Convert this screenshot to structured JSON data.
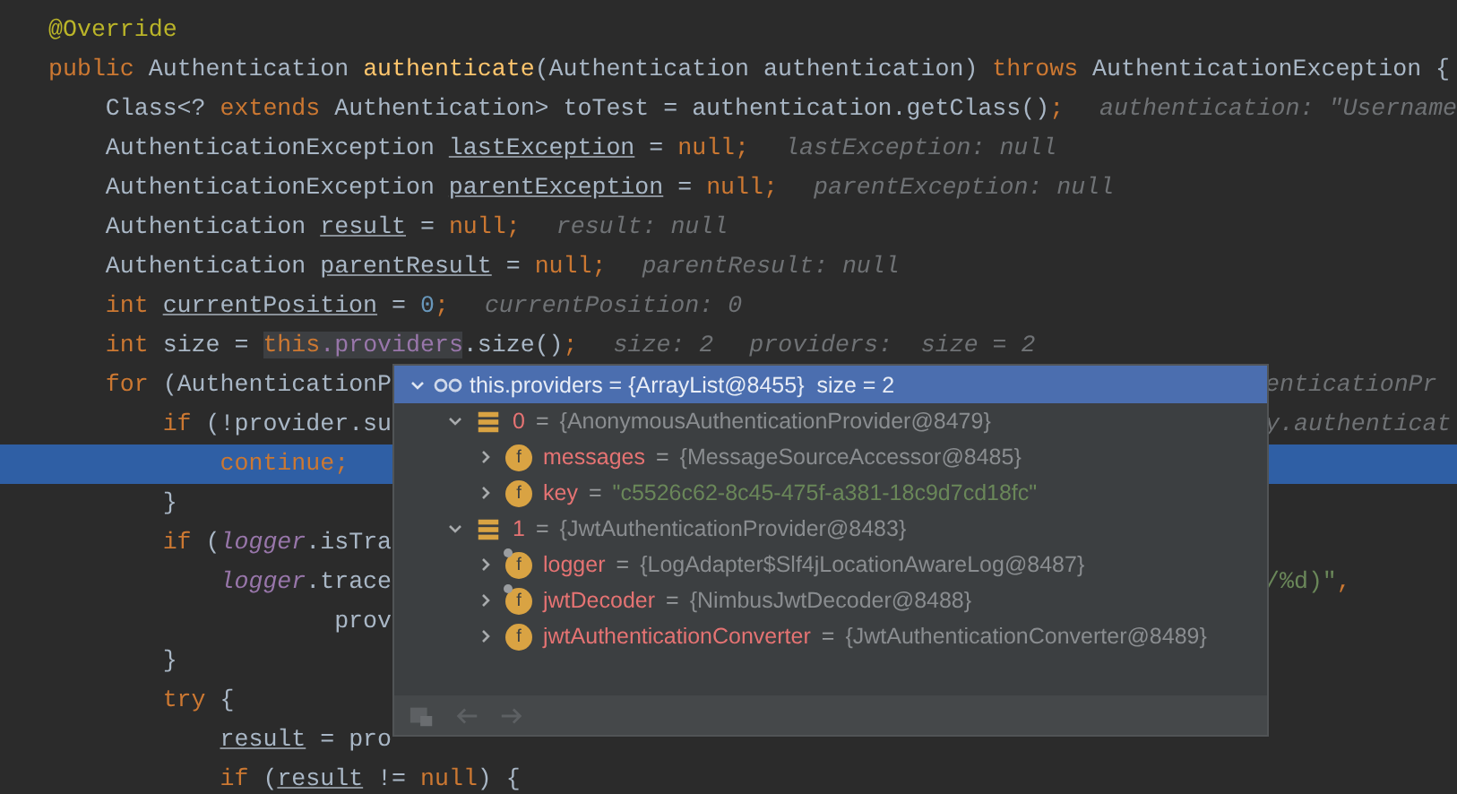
{
  "editor": {
    "lines": [
      {
        "current": false,
        "tokens": [
          {
            "kind": "annotation",
            "text": "@Override"
          }
        ]
      },
      {
        "current": false,
        "tokens": [
          {
            "kind": "keyword",
            "text": "public"
          },
          {
            "kind": "plain",
            "text": " Authentication "
          },
          {
            "kind": "method",
            "text": "authenticate"
          },
          {
            "kind": "plain",
            "text": "(Authentication authentication) "
          },
          {
            "kind": "keyword",
            "text": "throws"
          },
          {
            "kind": "plain",
            "text": " AuthenticationException {"
          }
        ],
        "children": [
          {
            "current": false,
            "tokens": [
              {
                "kind": "plain",
                "text": "Class<? "
              },
              {
                "kind": "keyword",
                "text": "extends"
              },
              {
                "kind": "plain",
                "text": " Authentication> toTest = authentication.getClass()"
              },
              {
                "kind": "keyword",
                "text": ";"
              },
              {
                "kind": "hint",
                "text": "authentication: \"Username"
              }
            ]
          },
          {
            "current": false,
            "tokens": [
              {
                "kind": "plain",
                "text": "AuthenticationException "
              },
              {
                "kind": "local",
                "text": "lastException"
              },
              {
                "kind": "plain",
                "text": " = "
              },
              {
                "kind": "keyword",
                "text": "null;"
              },
              {
                "kind": "hint",
                "text": "lastException: null"
              }
            ]
          },
          {
            "current": false,
            "tokens": [
              {
                "kind": "plain",
                "text": "AuthenticationException "
              },
              {
                "kind": "local",
                "text": "parentException"
              },
              {
                "kind": "plain",
                "text": " = "
              },
              {
                "kind": "keyword",
                "text": "null;"
              },
              {
                "kind": "hint",
                "text": "parentException: null"
              }
            ]
          },
          {
            "current": false,
            "tokens": [
              {
                "kind": "plain",
                "text": "Authentication "
              },
              {
                "kind": "local",
                "text": "result"
              },
              {
                "kind": "plain",
                "text": " = "
              },
              {
                "kind": "keyword",
                "text": "null;"
              },
              {
                "kind": "hint",
                "text": "result: null"
              }
            ]
          },
          {
            "current": false,
            "tokens": [
              {
                "kind": "plain",
                "text": "Authentication "
              },
              {
                "kind": "local",
                "text": "parentResult"
              },
              {
                "kind": "plain",
                "text": " = "
              },
              {
                "kind": "keyword",
                "text": "null;"
              },
              {
                "kind": "hint",
                "text": "parentResult: null"
              }
            ]
          },
          {
            "current": false,
            "tokens": [
              {
                "kind": "keyword",
                "text": "int "
              },
              {
                "kind": "local",
                "text": "currentPosition"
              },
              {
                "kind": "plain",
                "text": " = "
              },
              {
                "kind": "number",
                "text": "0"
              },
              {
                "kind": "keyword",
                "text": ";"
              },
              {
                "kind": "hint",
                "text": "currentPosition: 0"
              }
            ]
          },
          {
            "current": false,
            "tokens": [
              {
                "kind": "keyword",
                "text": "int"
              },
              {
                "kind": "plain",
                "text": " size = "
              },
              {
                "kind": "keyword",
                "text": "this",
                "highlighted": true
              },
              {
                "kind": "field",
                "text": ".providers",
                "highlighted": true
              },
              {
                "kind": "plain",
                "text": ".size()"
              },
              {
                "kind": "keyword",
                "text": ";"
              },
              {
                "kind": "hint",
                "text": "size: 2"
              },
              {
                "kind": "hint",
                "text": "providers:  size = 2"
              }
            ]
          },
          {
            "current": false,
            "tokens": [
              {
                "kind": "keyword",
                "text": "for"
              },
              {
                "kind": "plain",
                "text": " (AuthenticationP"
              }
            ],
            "tail": [
              {
                "kind": "hint",
                "text": "enticationPr"
              }
            ],
            "children": [
              {
                "current": false,
                "tokens": [
                  {
                    "kind": "keyword",
                    "text": "if"
                  },
                  {
                    "kind": "plain",
                    "text": " (!provider.su"
                  }
                ],
                "tail": [
                  {
                    "kind": "hint",
                    "text": "y.authenticat"
                  }
                ],
                "children": [
                  {
                    "current": true,
                    "tokens": [
                      {
                        "kind": "keyword",
                        "text": "continue;"
                      }
                    ]
                  }
                ]
              },
              {
                "current": false,
                "tokens": [
                  {
                    "kind": "plain",
                    "text": "}"
                  }
                ]
              },
              {
                "current": false,
                "tokens": [
                  {
                    "kind": "keyword",
                    "text": "if"
                  },
                  {
                    "kind": "plain",
                    "text": " ("
                  },
                  {
                    "kind": "static_field",
                    "text": "logger"
                  },
                  {
                    "kind": "plain",
                    "text": ".isTra"
                  }
                ],
                "children": [
                  {
                    "current": false,
                    "tokens": [
                      {
                        "kind": "static_field",
                        "text": "logger"
                      },
                      {
                        "kind": "plain",
                        "text": ".trace"
                      }
                    ],
                    "tail": [
                      {
                        "kind": "string",
                        "text": "/%d)\""
                      },
                      {
                        "kind": "keyword",
                        "text": ","
                      }
                    ],
                    "children": [
                      {
                        "kind": "continuation",
                        "current": false,
                        "tokens": [
                          {
                            "kind": "plain",
                            "text": "prov"
                          }
                        ]
                      }
                    ]
                  }
                ]
              },
              {
                "current": false,
                "tokens": [
                  {
                    "kind": "plain",
                    "text": "}"
                  }
                ]
              },
              {
                "current": false,
                "tokens": [
                  {
                    "kind": "keyword",
                    "text": "try"
                  },
                  {
                    "kind": "plain",
                    "text": " {"
                  }
                ],
                "children": [
                  {
                    "current": false,
                    "tokens": [
                      {
                        "kind": "local",
                        "text": "result"
                      },
                      {
                        "kind": "plain",
                        "text": " = pro"
                      }
                    ]
                  },
                  {
                    "current": false,
                    "tokens": [
                      {
                        "kind": "keyword",
                        "text": "if"
                      },
                      {
                        "kind": "plain",
                        "text": " ("
                      },
                      {
                        "kind": "local",
                        "text": "result"
                      },
                      {
                        "kind": "plain",
                        "text": " != "
                      },
                      {
                        "kind": "keyword",
                        "text": "null"
                      },
                      {
                        "kind": "plain",
                        "text": ") {"
                      }
                    ]
                  }
                ]
              }
            ]
          }
        ]
      }
    ]
  },
  "debug_popup": {
    "expanded": true,
    "label": "this.providers = {ArrayList@8455}  size = 2",
    "children": [
      {
        "kind": "element",
        "name": "0",
        "equals": "=",
        "value": "{AnonymousAuthenticationProvider@8479}",
        "marked": false,
        "expanded": true,
        "children": [
          {
            "kind": "field",
            "icon": "f",
            "name": "messages",
            "equals": "=",
            "value": "{MessageSourceAccessor@8485}",
            "marked": false,
            "expanded": false
          },
          {
            "kind": "string_field",
            "icon": "f",
            "name": "key",
            "equals": "=",
            "value": "\"c5526c62-8c45-475f-a381-18c9d7cd18fc\"",
            "marked": false,
            "expanded": false
          }
        ]
      },
      {
        "kind": "element",
        "name": "1",
        "equals": "=",
        "value": "{JwtAuthenticationProvider@8483}",
        "marked": false,
        "expanded": true,
        "children": [
          {
            "kind": "field",
            "icon": "f",
            "name": "logger",
            "equals": "=",
            "value": "{LogAdapter$Slf4jLocationAwareLog@8487}",
            "marked": true,
            "expanded": false
          },
          {
            "kind": "field",
            "icon": "f",
            "name": "jwtDecoder",
            "equals": "=",
            "value": "{NimbusJwtDecoder@8488}",
            "marked": true,
            "expanded": false
          },
          {
            "kind": "field",
            "icon": "f",
            "name": "jwtAuthenticationConverter",
            "equals": "=",
            "value": "{JwtAuthenticationConverter@8489}",
            "marked": false,
            "expanded": false
          }
        ]
      }
    ]
  }
}
